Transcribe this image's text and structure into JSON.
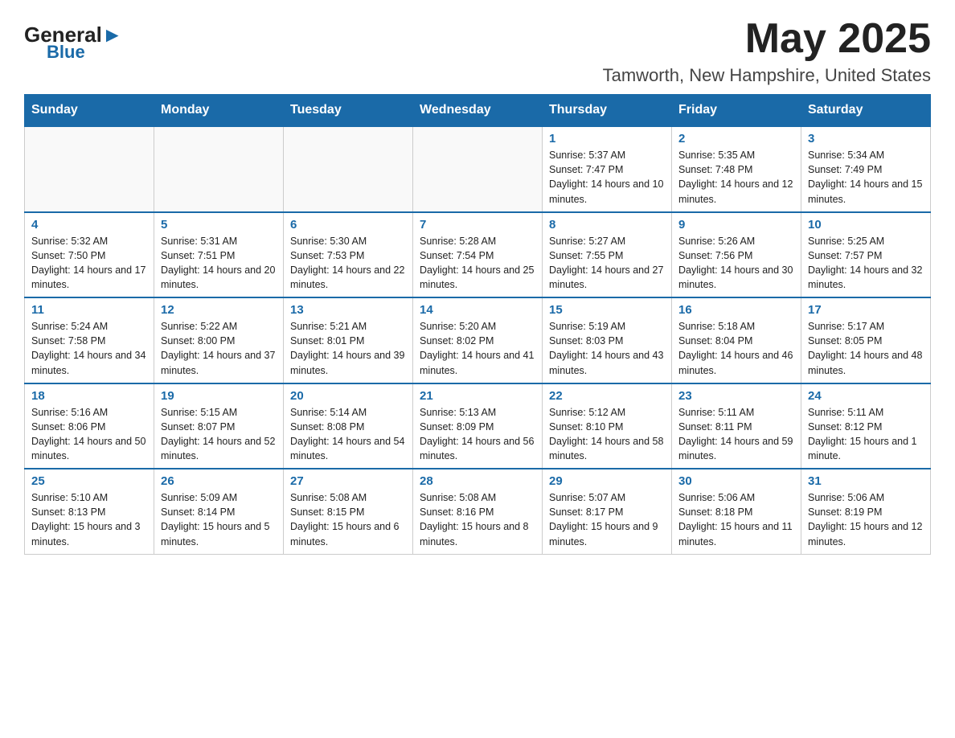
{
  "logo": {
    "general": "General",
    "arrow": "▲",
    "blue": "Blue"
  },
  "title": {
    "month": "May 2025",
    "location": "Tamworth, New Hampshire, United States"
  },
  "weekdays": [
    "Sunday",
    "Monday",
    "Tuesday",
    "Wednesday",
    "Thursday",
    "Friday",
    "Saturday"
  ],
  "weeks": [
    [
      {
        "day": "",
        "info": ""
      },
      {
        "day": "",
        "info": ""
      },
      {
        "day": "",
        "info": ""
      },
      {
        "day": "",
        "info": ""
      },
      {
        "day": "1",
        "info": "Sunrise: 5:37 AM\nSunset: 7:47 PM\nDaylight: 14 hours and 10 minutes."
      },
      {
        "day": "2",
        "info": "Sunrise: 5:35 AM\nSunset: 7:48 PM\nDaylight: 14 hours and 12 minutes."
      },
      {
        "day": "3",
        "info": "Sunrise: 5:34 AM\nSunset: 7:49 PM\nDaylight: 14 hours and 15 minutes."
      }
    ],
    [
      {
        "day": "4",
        "info": "Sunrise: 5:32 AM\nSunset: 7:50 PM\nDaylight: 14 hours and 17 minutes."
      },
      {
        "day": "5",
        "info": "Sunrise: 5:31 AM\nSunset: 7:51 PM\nDaylight: 14 hours and 20 minutes."
      },
      {
        "day": "6",
        "info": "Sunrise: 5:30 AM\nSunset: 7:53 PM\nDaylight: 14 hours and 22 minutes."
      },
      {
        "day": "7",
        "info": "Sunrise: 5:28 AM\nSunset: 7:54 PM\nDaylight: 14 hours and 25 minutes."
      },
      {
        "day": "8",
        "info": "Sunrise: 5:27 AM\nSunset: 7:55 PM\nDaylight: 14 hours and 27 minutes."
      },
      {
        "day": "9",
        "info": "Sunrise: 5:26 AM\nSunset: 7:56 PM\nDaylight: 14 hours and 30 minutes."
      },
      {
        "day": "10",
        "info": "Sunrise: 5:25 AM\nSunset: 7:57 PM\nDaylight: 14 hours and 32 minutes."
      }
    ],
    [
      {
        "day": "11",
        "info": "Sunrise: 5:24 AM\nSunset: 7:58 PM\nDaylight: 14 hours and 34 minutes."
      },
      {
        "day": "12",
        "info": "Sunrise: 5:22 AM\nSunset: 8:00 PM\nDaylight: 14 hours and 37 minutes."
      },
      {
        "day": "13",
        "info": "Sunrise: 5:21 AM\nSunset: 8:01 PM\nDaylight: 14 hours and 39 minutes."
      },
      {
        "day": "14",
        "info": "Sunrise: 5:20 AM\nSunset: 8:02 PM\nDaylight: 14 hours and 41 minutes."
      },
      {
        "day": "15",
        "info": "Sunrise: 5:19 AM\nSunset: 8:03 PM\nDaylight: 14 hours and 43 minutes."
      },
      {
        "day": "16",
        "info": "Sunrise: 5:18 AM\nSunset: 8:04 PM\nDaylight: 14 hours and 46 minutes."
      },
      {
        "day": "17",
        "info": "Sunrise: 5:17 AM\nSunset: 8:05 PM\nDaylight: 14 hours and 48 minutes."
      }
    ],
    [
      {
        "day": "18",
        "info": "Sunrise: 5:16 AM\nSunset: 8:06 PM\nDaylight: 14 hours and 50 minutes."
      },
      {
        "day": "19",
        "info": "Sunrise: 5:15 AM\nSunset: 8:07 PM\nDaylight: 14 hours and 52 minutes."
      },
      {
        "day": "20",
        "info": "Sunrise: 5:14 AM\nSunset: 8:08 PM\nDaylight: 14 hours and 54 minutes."
      },
      {
        "day": "21",
        "info": "Sunrise: 5:13 AM\nSunset: 8:09 PM\nDaylight: 14 hours and 56 minutes."
      },
      {
        "day": "22",
        "info": "Sunrise: 5:12 AM\nSunset: 8:10 PM\nDaylight: 14 hours and 58 minutes."
      },
      {
        "day": "23",
        "info": "Sunrise: 5:11 AM\nSunset: 8:11 PM\nDaylight: 14 hours and 59 minutes."
      },
      {
        "day": "24",
        "info": "Sunrise: 5:11 AM\nSunset: 8:12 PM\nDaylight: 15 hours and 1 minute."
      }
    ],
    [
      {
        "day": "25",
        "info": "Sunrise: 5:10 AM\nSunset: 8:13 PM\nDaylight: 15 hours and 3 minutes."
      },
      {
        "day": "26",
        "info": "Sunrise: 5:09 AM\nSunset: 8:14 PM\nDaylight: 15 hours and 5 minutes."
      },
      {
        "day": "27",
        "info": "Sunrise: 5:08 AM\nSunset: 8:15 PM\nDaylight: 15 hours and 6 minutes."
      },
      {
        "day": "28",
        "info": "Sunrise: 5:08 AM\nSunset: 8:16 PM\nDaylight: 15 hours and 8 minutes."
      },
      {
        "day": "29",
        "info": "Sunrise: 5:07 AM\nSunset: 8:17 PM\nDaylight: 15 hours and 9 minutes."
      },
      {
        "day": "30",
        "info": "Sunrise: 5:06 AM\nSunset: 8:18 PM\nDaylight: 15 hours and 11 minutes."
      },
      {
        "day": "31",
        "info": "Sunrise: 5:06 AM\nSunset: 8:19 PM\nDaylight: 15 hours and 12 minutes."
      }
    ]
  ]
}
